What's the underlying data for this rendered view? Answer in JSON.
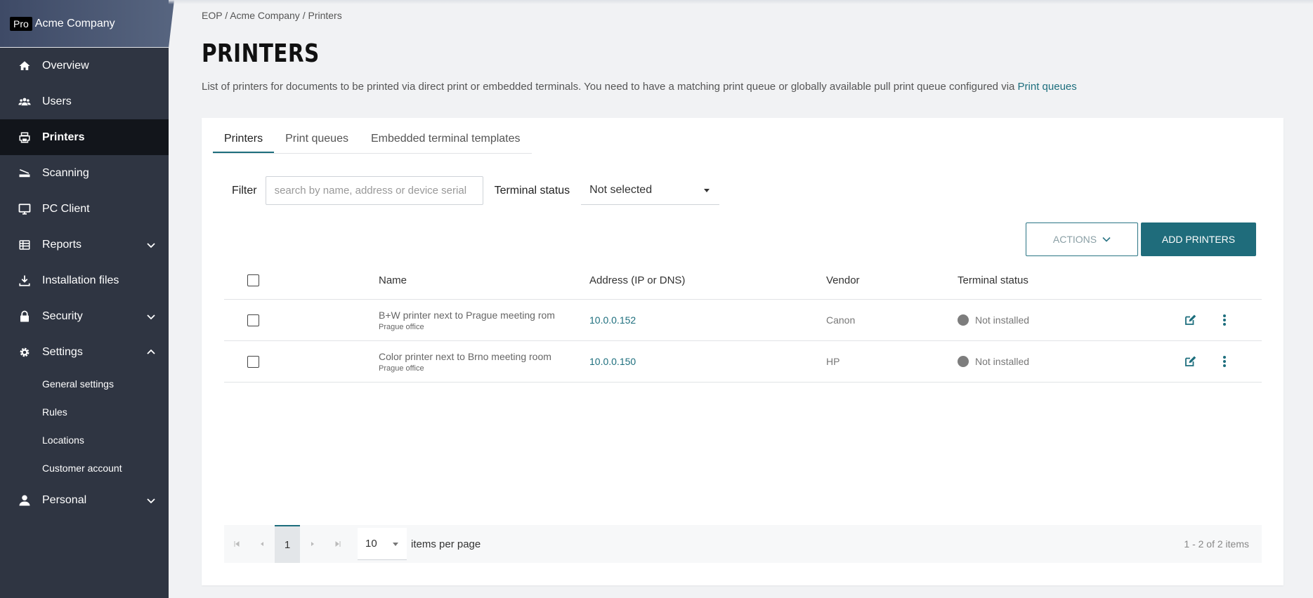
{
  "brand": {
    "badge": "Pro",
    "name": "Acme Company"
  },
  "sidebar": {
    "items": [
      {
        "label": "Overview",
        "icon": "home-icon"
      },
      {
        "label": "Users",
        "icon": "users-icon"
      },
      {
        "label": "Printers",
        "icon": "printer-icon",
        "active": true
      },
      {
        "label": "Scanning",
        "icon": "scanner-icon"
      },
      {
        "label": "PC Client",
        "icon": "monitor-icon"
      },
      {
        "label": "Reports",
        "icon": "reports-icon",
        "expandable": true
      },
      {
        "label": "Installation files",
        "icon": "download-icon"
      },
      {
        "label": "Security",
        "icon": "lock-icon",
        "expandable": true
      },
      {
        "label": "Settings",
        "icon": "gear-icon",
        "expanded": true
      }
    ],
    "settings_sub": [
      "General settings",
      "Rules",
      "Locations",
      "Customer account"
    ],
    "personal": {
      "label": "Personal",
      "icon": "person-icon"
    }
  },
  "breadcrumb": [
    "EOP",
    "Acme Company",
    "Printers"
  ],
  "page": {
    "title": "PRINTERS",
    "description": "List of printers for documents to be printed via direct print or embedded terminals. You need to have a matching print queue or globally available pull print queue configured via ",
    "description_link": "Print queues"
  },
  "tabs": [
    "Printers",
    "Print queues",
    "Embedded terminal templates"
  ],
  "filter": {
    "label": "Filter",
    "placeholder": "search by name, address or device serial",
    "status_label": "Terminal status",
    "status_value": "Not selected"
  },
  "buttons": {
    "actions": "ACTIONS",
    "add": "ADD PRINTERS"
  },
  "table": {
    "headers": {
      "name": "Name",
      "address": "Address (IP or DNS)",
      "vendor": "Vendor",
      "status": "Terminal status"
    },
    "rows": [
      {
        "name": "B+W printer next to Prague meeting rom",
        "location": "Prague office",
        "address": "10.0.0.152",
        "vendor": "Canon",
        "status": "Not installed"
      },
      {
        "name": "Color printer next to Brno meeting room",
        "location": "Prague office",
        "address": "10.0.0.150",
        "vendor": "HP",
        "status": "Not installed"
      }
    ]
  },
  "pager": {
    "page": "1",
    "page_size": "10",
    "per_page_label": "items per page",
    "info": "1 - 2 of 2 items"
  },
  "colors": {
    "accent": "#1f6c7b",
    "sidebar": "#2f3542",
    "active": "#12151b"
  }
}
